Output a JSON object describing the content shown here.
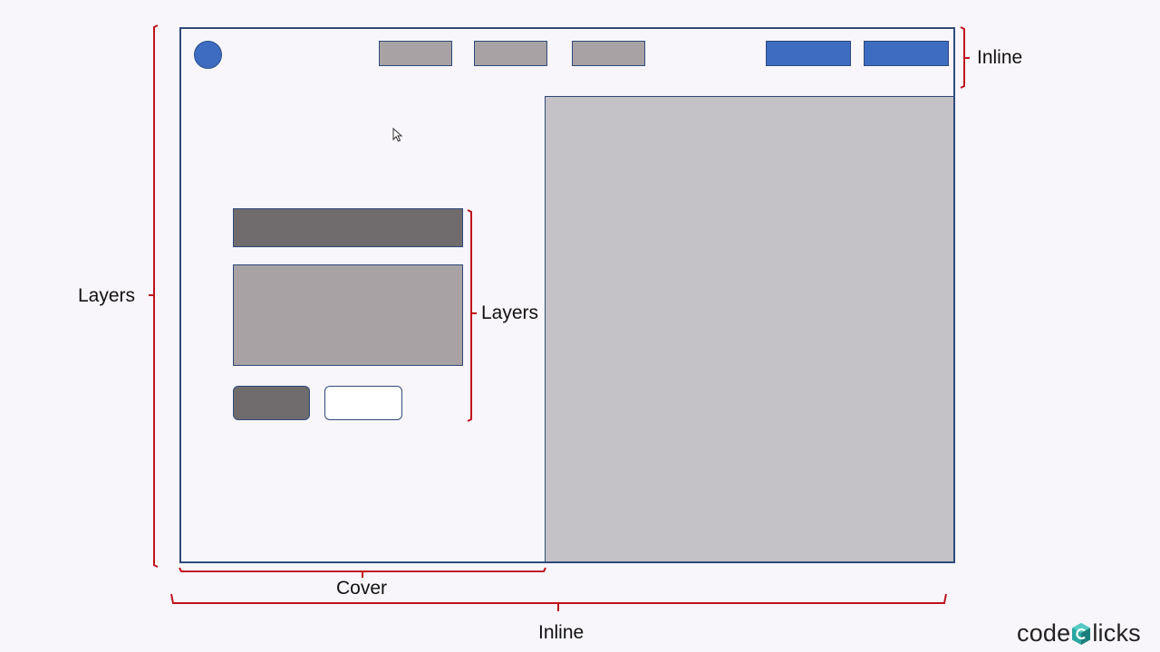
{
  "annotations": {
    "left_label": "Layers",
    "inner_label": "Layers",
    "top_right_label": "Inline",
    "cover_label": "Cover",
    "bottom_label": "Inline"
  },
  "brand": {
    "prefix": "code",
    "suffix": "licks",
    "icon": "cube-c-icon"
  },
  "colors": {
    "bracket": "#c0121c",
    "frame_border": "#2f4a7a",
    "accent_blue": "#3d6cc0",
    "dark_gray": "#706b6c",
    "mid_gray": "#a8a2a4",
    "light_gray": "#c4c2c6",
    "brand_teal": "#2aa7a3"
  }
}
